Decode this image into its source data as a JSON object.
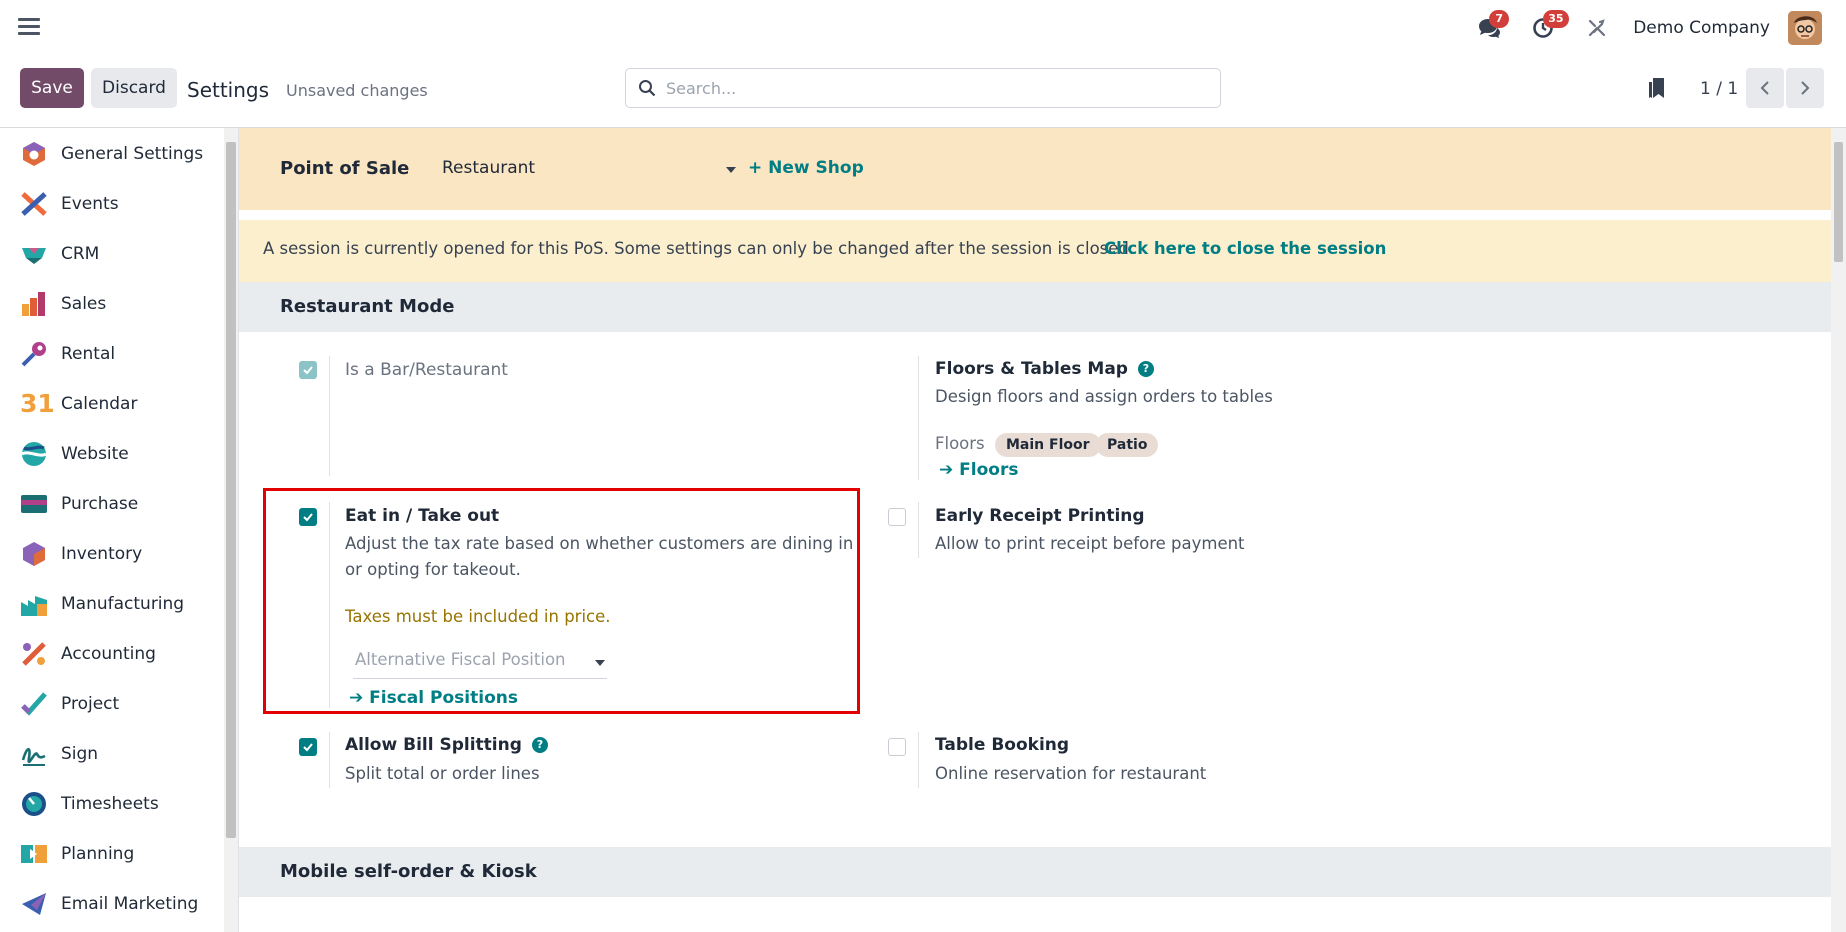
{
  "navbar": {
    "messages_badge": "7",
    "activity_badge": "35",
    "company": "Demo Company"
  },
  "control_panel": {
    "save_label": "Save",
    "discard_label": "Discard",
    "title": "Settings",
    "status": "Unsaved changes",
    "search_placeholder": "Search...",
    "pager": "1 / 1"
  },
  "sidebar": {
    "items": [
      {
        "label": "General Settings",
        "icon": "general-settings-icon"
      },
      {
        "label": "Events",
        "icon": "events-icon"
      },
      {
        "label": "CRM",
        "icon": "crm-icon"
      },
      {
        "label": "Sales",
        "icon": "sales-icon"
      },
      {
        "label": "Rental",
        "icon": "rental-icon"
      },
      {
        "label": "Calendar",
        "icon": "calendar-icon"
      },
      {
        "label": "Website",
        "icon": "website-icon"
      },
      {
        "label": "Purchase",
        "icon": "purchase-icon"
      },
      {
        "label": "Inventory",
        "icon": "inventory-icon"
      },
      {
        "label": "Manufacturing",
        "icon": "manufacturing-icon"
      },
      {
        "label": "Accounting",
        "icon": "accounting-icon"
      },
      {
        "label": "Project",
        "icon": "project-icon"
      },
      {
        "label": "Sign",
        "icon": "sign-icon"
      },
      {
        "label": "Timesheets",
        "icon": "timesheets-icon"
      },
      {
        "label": "Planning",
        "icon": "planning-icon"
      },
      {
        "label": "Email Marketing",
        "icon": "email-marketing-icon"
      }
    ],
    "calendar_glyph": "31"
  },
  "pos_bar": {
    "label": "Point of Sale",
    "selected_shop": "Restaurant",
    "new_shop": "+ New Shop"
  },
  "alert": {
    "text": "A session is currently opened for this PoS. Some settings can only be changed after the session is closed.",
    "link": "Click here to close the session"
  },
  "restaurant_mode": {
    "heading": "Restaurant Mode",
    "is_bar": {
      "label": "Is a Bar/Restaurant",
      "checked": true
    },
    "floors_map": {
      "title": "Floors & Tables Map",
      "description": "Design floors and assign orders to tables",
      "floors_label": "Floors",
      "floors": [
        "Main Floor",
        "Patio"
      ],
      "link": "Floors"
    },
    "eat_in": {
      "title": "Eat in / Take out",
      "description": "Adjust the tax rate based on whether customers are dining in or opting for takeout.",
      "warning": "Taxes must be included in price.",
      "fiscal_placeholder": "Alternative Fiscal Position",
      "link": "Fiscal Positions",
      "checked": true
    },
    "early_receipt": {
      "title": "Early Receipt Printing",
      "description": "Allow to print receipt before payment",
      "checked": false
    },
    "bill_splitting": {
      "title": "Allow Bill Splitting",
      "description": "Split total or order lines",
      "checked": true
    },
    "table_booking": {
      "title": "Table Booking",
      "description": "Online reservation for restaurant",
      "checked": false
    }
  },
  "mobile_section": {
    "heading": "Mobile self-order & Kiosk"
  },
  "colors": {
    "primary": "#714b67",
    "accent": "#017e84",
    "badge": "#d23f3a",
    "highlight": "#e30000"
  }
}
